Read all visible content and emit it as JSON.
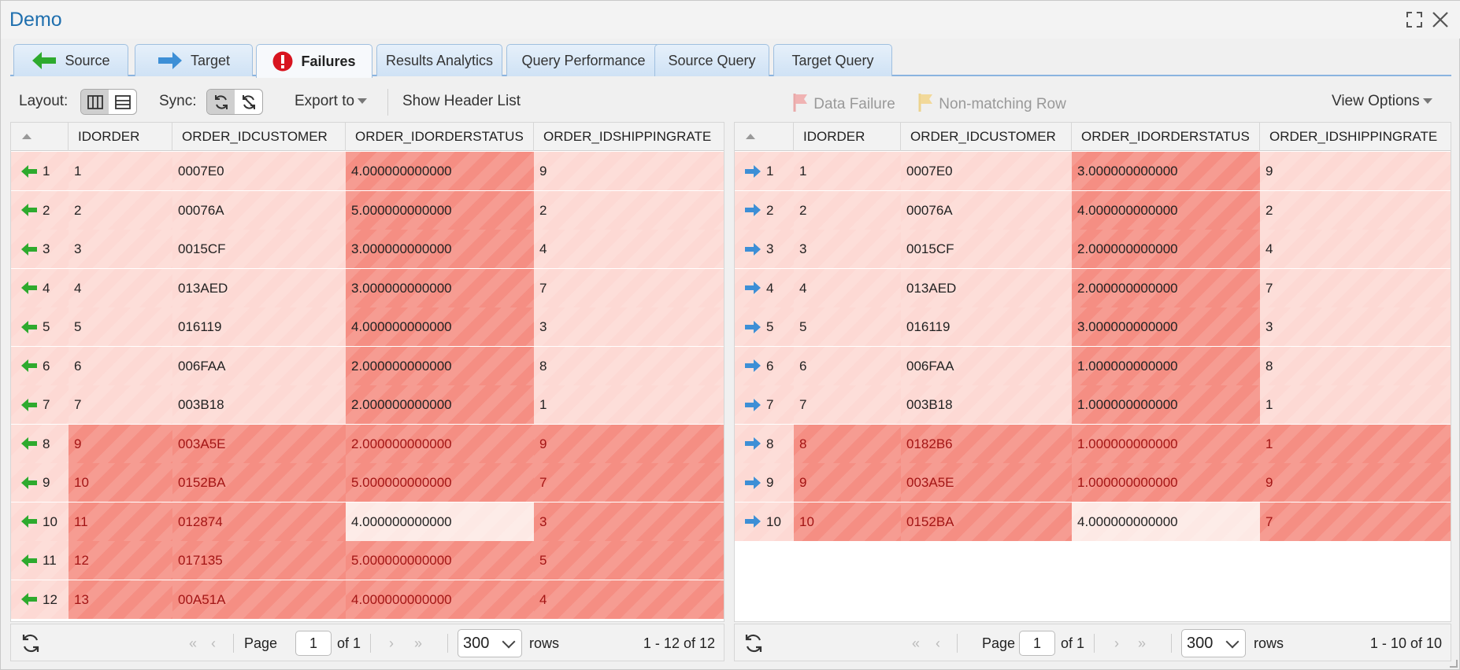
{
  "window": {
    "title": "Demo"
  },
  "tabs": [
    {
      "label": "Source",
      "icon": "arrow-left-green-icon"
    },
    {
      "label": "Target",
      "icon": "arrow-right-blue-icon"
    },
    {
      "label": "Failures",
      "icon": "exclamation-red-icon",
      "active": true
    },
    {
      "label": "Results Analytics"
    },
    {
      "label": "Query Performance"
    },
    {
      "label": "Source Query"
    },
    {
      "label": "Target Query"
    }
  ],
  "toolbar": {
    "layout_label": "Layout:",
    "sync_label": "Sync:",
    "export_label": "Export to",
    "show_header_label": "Show Header List",
    "data_failure_label": "Data Failure",
    "nonmatching_label": "Non-matching Row",
    "view_options_label": "View Options"
  },
  "colors": {
    "accent": "#1f6fae",
    "light_failure": "#fdd9d4",
    "cell_failure": "#f58e83",
    "row_nonmatch": "#f8aea4",
    "source_arrow": "#2eaa2e",
    "target_arrow": "#3d8fd6"
  },
  "source_grid": {
    "columns": [
      "IDORDER",
      "ORDER_IDCUSTOMER",
      "ORDER_IDORDERSTATUS",
      "ORDER_IDSHIPPINGRATE"
    ],
    "rows": [
      {
        "n": "1",
        "cells": [
          "1",
          "0007E0",
          "4.000000000000",
          "9"
        ],
        "type": "diff"
      },
      {
        "n": "2",
        "cells": [
          "2",
          "00076A",
          "5.000000000000",
          "2"
        ],
        "type": "diff"
      },
      {
        "n": "3",
        "cells": [
          "3",
          "0015CF",
          "3.000000000000",
          "4"
        ],
        "type": "diff"
      },
      {
        "n": "4",
        "cells": [
          "4",
          "013AED",
          "3.000000000000",
          "7"
        ],
        "type": "diff"
      },
      {
        "n": "5",
        "cells": [
          "5",
          "016119",
          "4.000000000000",
          "3"
        ],
        "type": "diff"
      },
      {
        "n": "6",
        "cells": [
          "6",
          "006FAA",
          "2.000000000000",
          "8"
        ],
        "type": "diff"
      },
      {
        "n": "7",
        "cells": [
          "7",
          "003B18",
          "2.000000000000",
          "1"
        ],
        "type": "diff"
      },
      {
        "n": "8",
        "cells": [
          "9",
          "003A5E",
          "2.000000000000",
          "9"
        ],
        "type": "nonmatch"
      },
      {
        "n": "9",
        "cells": [
          "10",
          "0152BA",
          "5.000000000000",
          "7"
        ],
        "type": "nonmatch"
      },
      {
        "n": "10",
        "cells": [
          "11",
          "012874",
          "4.000000000000",
          "3"
        ],
        "type": "nonmatch-hole"
      },
      {
        "n": "11",
        "cells": [
          "12",
          "017135",
          "5.000000000000",
          "5"
        ],
        "type": "nonmatch"
      },
      {
        "n": "12",
        "cells": [
          "13",
          "00A51A",
          "4.000000000000",
          "4"
        ],
        "type": "nonmatch"
      }
    ],
    "pager": {
      "page_label": "Page",
      "page": "1",
      "of_label": "of 1",
      "page_size": "300",
      "rows_label": "rows",
      "summary": "1 - 12 of 12"
    }
  },
  "target_grid": {
    "columns": [
      "IDORDER",
      "ORDER_IDCUSTOMER",
      "ORDER_IDORDERSTATUS",
      "ORDER_IDSHIPPINGRATE"
    ],
    "rows": [
      {
        "n": "1",
        "cells": [
          "1",
          "0007E0",
          "3.000000000000",
          "9"
        ],
        "type": "diff"
      },
      {
        "n": "2",
        "cells": [
          "2",
          "00076A",
          "4.000000000000",
          "2"
        ],
        "type": "diff"
      },
      {
        "n": "3",
        "cells": [
          "3",
          "0015CF",
          "2.000000000000",
          "4"
        ],
        "type": "diff"
      },
      {
        "n": "4",
        "cells": [
          "4",
          "013AED",
          "2.000000000000",
          "7"
        ],
        "type": "diff"
      },
      {
        "n": "5",
        "cells": [
          "5",
          "016119",
          "3.000000000000",
          "3"
        ],
        "type": "diff"
      },
      {
        "n": "6",
        "cells": [
          "6",
          "006FAA",
          "1.000000000000",
          "8"
        ],
        "type": "diff"
      },
      {
        "n": "7",
        "cells": [
          "7",
          "003B18",
          "1.000000000000",
          "1"
        ],
        "type": "diff"
      },
      {
        "n": "8",
        "cells": [
          "8",
          "0182B6",
          "1.000000000000",
          "1"
        ],
        "type": "nonmatch"
      },
      {
        "n": "9",
        "cells": [
          "9",
          "003A5E",
          "1.000000000000",
          "9"
        ],
        "type": "nonmatch"
      },
      {
        "n": "10",
        "cells": [
          "10",
          "0152BA",
          "4.000000000000",
          "7"
        ],
        "type": "nonmatch-hole"
      }
    ],
    "pager": {
      "page_label": "Page",
      "page": "1",
      "of_label": "of 1",
      "page_size": "300",
      "rows_label": "rows",
      "summary": "1 - 10 of 10"
    }
  }
}
